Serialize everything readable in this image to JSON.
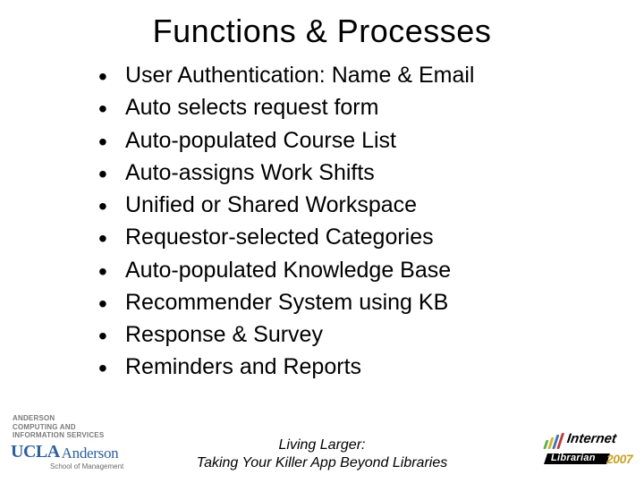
{
  "title": "Functions & Processes",
  "bullets": [
    "User Authentication: Name & Email",
    "Auto selects request form",
    "Auto-populated Course List",
    "Auto-assigns Work Shifts",
    "Unified or Shared Workspace",
    "Requestor-selected Categories",
    "Auto-populated Knowledge Base",
    "Recommender System using KB",
    "Response & Survey",
    "Reminders and Reports"
  ],
  "footer": {
    "line1": "Living Larger:",
    "line2": "Taking Your Killer App Beyond Libraries"
  },
  "logo_left": {
    "cis_line1": "ANDERSON",
    "cis_line2": "COMPUTING AND",
    "cis_line3": "INFORMATION SERVICES",
    "ucla": "UCLA",
    "anderson": "Anderson",
    "school": "School of Management"
  },
  "logo_right": {
    "top": "Internet",
    "bottom": "Librarian",
    "year": "2007"
  }
}
